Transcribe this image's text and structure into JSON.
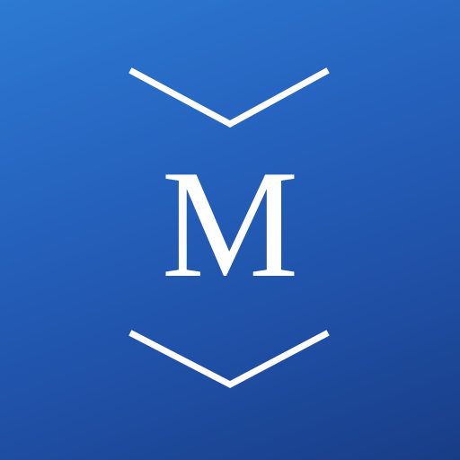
{
  "icon": {
    "letter": "M",
    "top_icon": "chevron-down-icon",
    "bottom_icon": "chevron-down-icon",
    "colors": {
      "gradient_top": "#2d7ad2",
      "gradient_bottom": "#183d86",
      "foreground": "#ffffff"
    }
  }
}
